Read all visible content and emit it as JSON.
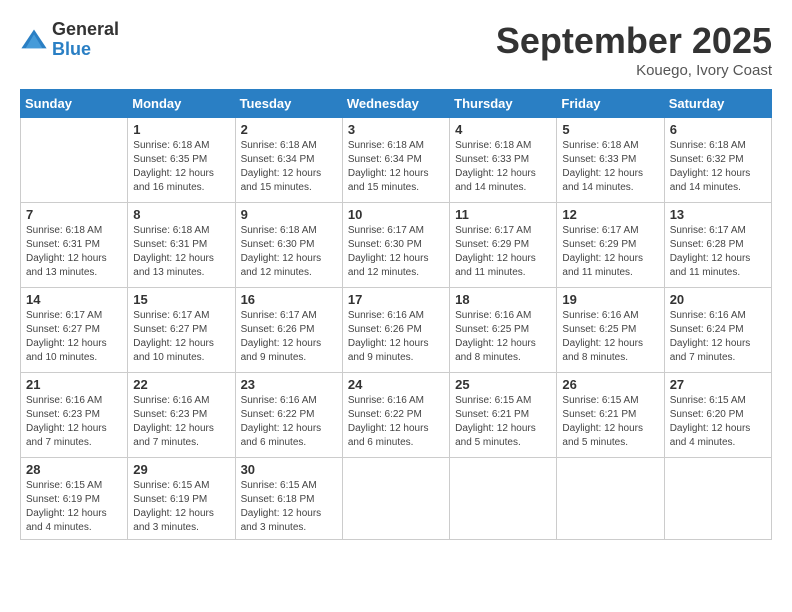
{
  "header": {
    "logo_line1": "General",
    "logo_line2": "Blue",
    "month_title": "September 2025",
    "location": "Kouego, Ivory Coast"
  },
  "weekdays": [
    "Sunday",
    "Monday",
    "Tuesday",
    "Wednesday",
    "Thursday",
    "Friday",
    "Saturday"
  ],
  "weeks": [
    [
      {
        "day": "",
        "sunrise": "",
        "sunset": "",
        "daylight": ""
      },
      {
        "day": "1",
        "sunrise": "Sunrise: 6:18 AM",
        "sunset": "Sunset: 6:35 PM",
        "daylight": "Daylight: 12 hours and 16 minutes."
      },
      {
        "day": "2",
        "sunrise": "Sunrise: 6:18 AM",
        "sunset": "Sunset: 6:34 PM",
        "daylight": "Daylight: 12 hours and 15 minutes."
      },
      {
        "day": "3",
        "sunrise": "Sunrise: 6:18 AM",
        "sunset": "Sunset: 6:34 PM",
        "daylight": "Daylight: 12 hours and 15 minutes."
      },
      {
        "day": "4",
        "sunrise": "Sunrise: 6:18 AM",
        "sunset": "Sunset: 6:33 PM",
        "daylight": "Daylight: 12 hours and 14 minutes."
      },
      {
        "day": "5",
        "sunrise": "Sunrise: 6:18 AM",
        "sunset": "Sunset: 6:33 PM",
        "daylight": "Daylight: 12 hours and 14 minutes."
      },
      {
        "day": "6",
        "sunrise": "Sunrise: 6:18 AM",
        "sunset": "Sunset: 6:32 PM",
        "daylight": "Daylight: 12 hours and 14 minutes."
      }
    ],
    [
      {
        "day": "7",
        "sunrise": "Sunrise: 6:18 AM",
        "sunset": "Sunset: 6:31 PM",
        "daylight": "Daylight: 12 hours and 13 minutes."
      },
      {
        "day": "8",
        "sunrise": "Sunrise: 6:18 AM",
        "sunset": "Sunset: 6:31 PM",
        "daylight": "Daylight: 12 hours and 13 minutes."
      },
      {
        "day": "9",
        "sunrise": "Sunrise: 6:18 AM",
        "sunset": "Sunset: 6:30 PM",
        "daylight": "Daylight: 12 hours and 12 minutes."
      },
      {
        "day": "10",
        "sunrise": "Sunrise: 6:17 AM",
        "sunset": "Sunset: 6:30 PM",
        "daylight": "Daylight: 12 hours and 12 minutes."
      },
      {
        "day": "11",
        "sunrise": "Sunrise: 6:17 AM",
        "sunset": "Sunset: 6:29 PM",
        "daylight": "Daylight: 12 hours and 11 minutes."
      },
      {
        "day": "12",
        "sunrise": "Sunrise: 6:17 AM",
        "sunset": "Sunset: 6:29 PM",
        "daylight": "Daylight: 12 hours and 11 minutes."
      },
      {
        "day": "13",
        "sunrise": "Sunrise: 6:17 AM",
        "sunset": "Sunset: 6:28 PM",
        "daylight": "Daylight: 12 hours and 11 minutes."
      }
    ],
    [
      {
        "day": "14",
        "sunrise": "Sunrise: 6:17 AM",
        "sunset": "Sunset: 6:27 PM",
        "daylight": "Daylight: 12 hours and 10 minutes."
      },
      {
        "day": "15",
        "sunrise": "Sunrise: 6:17 AM",
        "sunset": "Sunset: 6:27 PM",
        "daylight": "Daylight: 12 hours and 10 minutes."
      },
      {
        "day": "16",
        "sunrise": "Sunrise: 6:17 AM",
        "sunset": "Sunset: 6:26 PM",
        "daylight": "Daylight: 12 hours and 9 minutes."
      },
      {
        "day": "17",
        "sunrise": "Sunrise: 6:16 AM",
        "sunset": "Sunset: 6:26 PM",
        "daylight": "Daylight: 12 hours and 9 minutes."
      },
      {
        "day": "18",
        "sunrise": "Sunrise: 6:16 AM",
        "sunset": "Sunset: 6:25 PM",
        "daylight": "Daylight: 12 hours and 8 minutes."
      },
      {
        "day": "19",
        "sunrise": "Sunrise: 6:16 AM",
        "sunset": "Sunset: 6:25 PM",
        "daylight": "Daylight: 12 hours and 8 minutes."
      },
      {
        "day": "20",
        "sunrise": "Sunrise: 6:16 AM",
        "sunset": "Sunset: 6:24 PM",
        "daylight": "Daylight: 12 hours and 7 minutes."
      }
    ],
    [
      {
        "day": "21",
        "sunrise": "Sunrise: 6:16 AM",
        "sunset": "Sunset: 6:23 PM",
        "daylight": "Daylight: 12 hours and 7 minutes."
      },
      {
        "day": "22",
        "sunrise": "Sunrise: 6:16 AM",
        "sunset": "Sunset: 6:23 PM",
        "daylight": "Daylight: 12 hours and 7 minutes."
      },
      {
        "day": "23",
        "sunrise": "Sunrise: 6:16 AM",
        "sunset": "Sunset: 6:22 PM",
        "daylight": "Daylight: 12 hours and 6 minutes."
      },
      {
        "day": "24",
        "sunrise": "Sunrise: 6:16 AM",
        "sunset": "Sunset: 6:22 PM",
        "daylight": "Daylight: 12 hours and 6 minutes."
      },
      {
        "day": "25",
        "sunrise": "Sunrise: 6:15 AM",
        "sunset": "Sunset: 6:21 PM",
        "daylight": "Daylight: 12 hours and 5 minutes."
      },
      {
        "day": "26",
        "sunrise": "Sunrise: 6:15 AM",
        "sunset": "Sunset: 6:21 PM",
        "daylight": "Daylight: 12 hours and 5 minutes."
      },
      {
        "day": "27",
        "sunrise": "Sunrise: 6:15 AM",
        "sunset": "Sunset: 6:20 PM",
        "daylight": "Daylight: 12 hours and 4 minutes."
      }
    ],
    [
      {
        "day": "28",
        "sunrise": "Sunrise: 6:15 AM",
        "sunset": "Sunset: 6:19 PM",
        "daylight": "Daylight: 12 hours and 4 minutes."
      },
      {
        "day": "29",
        "sunrise": "Sunrise: 6:15 AM",
        "sunset": "Sunset: 6:19 PM",
        "daylight": "Daylight: 12 hours and 3 minutes."
      },
      {
        "day": "30",
        "sunrise": "Sunrise: 6:15 AM",
        "sunset": "Sunset: 6:18 PM",
        "daylight": "Daylight: 12 hours and 3 minutes."
      },
      {
        "day": "",
        "sunrise": "",
        "sunset": "",
        "daylight": ""
      },
      {
        "day": "",
        "sunrise": "",
        "sunset": "",
        "daylight": ""
      },
      {
        "day": "",
        "sunrise": "",
        "sunset": "",
        "daylight": ""
      },
      {
        "day": "",
        "sunrise": "",
        "sunset": "",
        "daylight": ""
      }
    ]
  ]
}
